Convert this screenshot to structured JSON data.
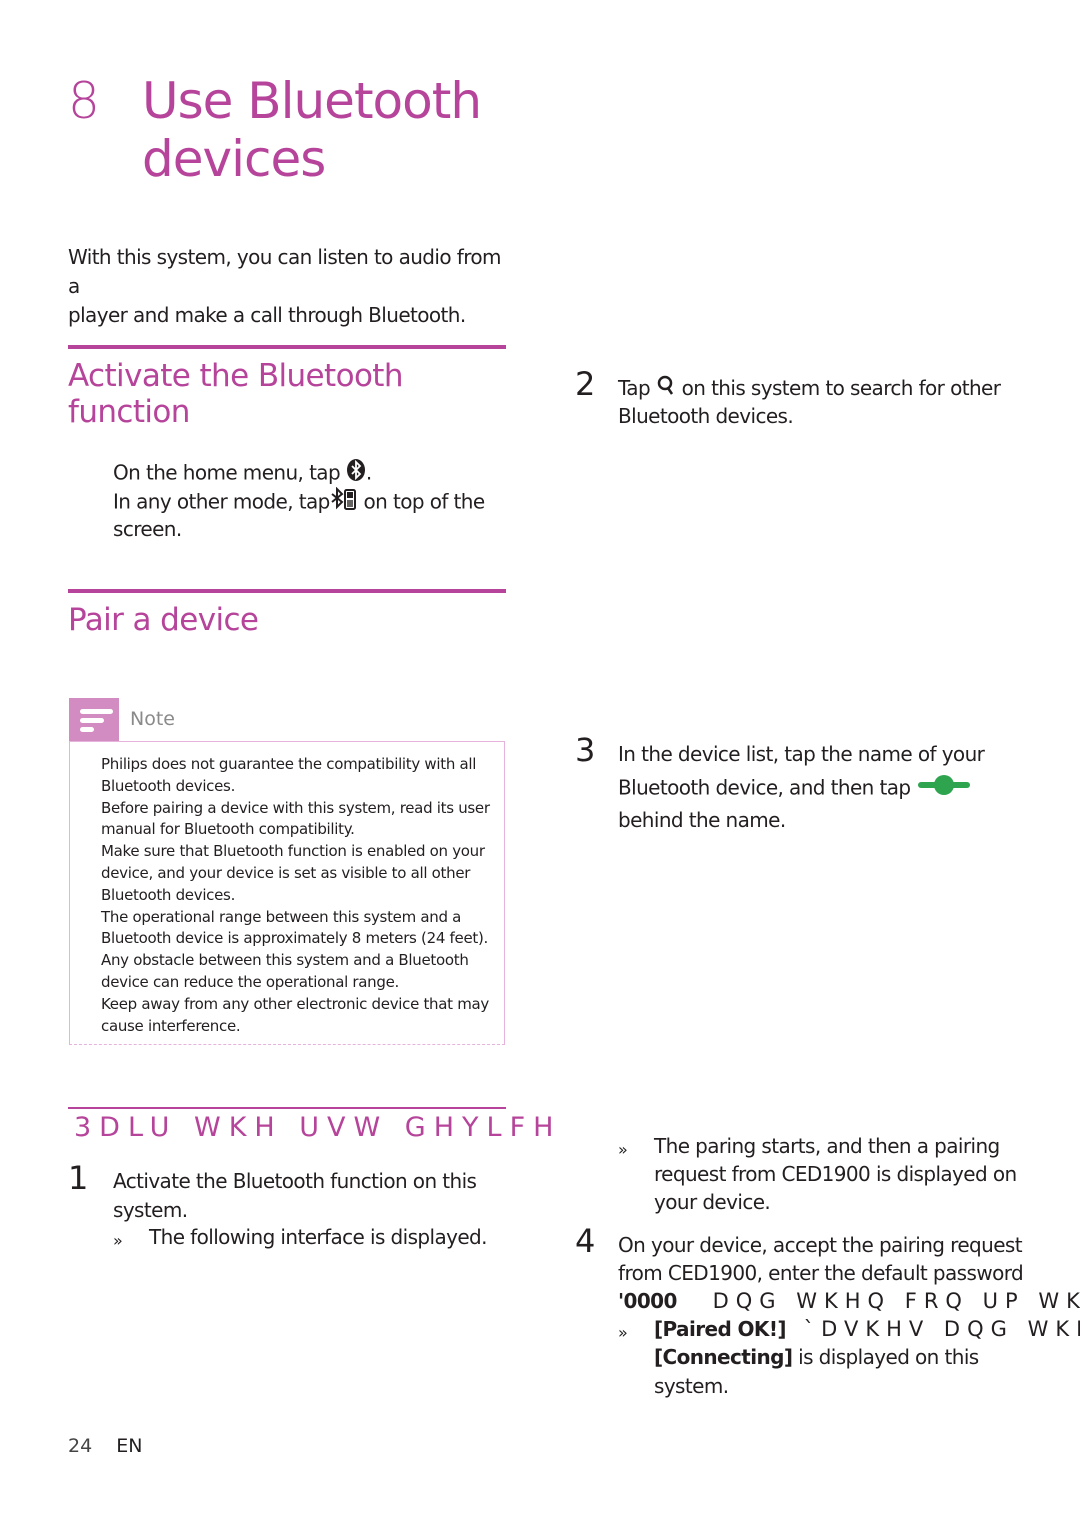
{
  "chapter": {
    "number": "8",
    "title_line1": "Use Bluetooth",
    "title_line2": "devices"
  },
  "intro": {
    "line1": "With this system, you can listen to audio from a",
    "line2": "player and make a call through Bluetooth."
  },
  "activate_section": {
    "heading_line1": "Activate the Bluetooth",
    "heading_line2": "function",
    "line1_before": "On the home menu, tap",
    "line1_after": ".",
    "line2_before": "In any other mode, tap",
    "line2_after": "on top of the",
    "line3": "screen.",
    "icons": [
      "bluetooth-home-icon",
      "bluetooth-phone-icon"
    ]
  },
  "pair_section": {
    "heading": "Pair a device"
  },
  "note": {
    "label": "Note",
    "icon": "note-icon",
    "lines": [
      "Philips does not guarantee the compatibility with all",
      "Bluetooth devices.",
      "Before pairing a device with this system, read its user",
      "manual for Bluetooth compatibility.",
      "Make sure that Bluetooth function is enabled on your",
      "device, and your device is set as visible to all other",
      "Bluetooth devices.",
      "The operational range between this system and a",
      "Bluetooth device is approximately 8 meters (24 feet).",
      "Any obstacle between this system and a Bluetooth",
      "device can reduce the operational range.",
      "Keep away from any other electronic device that may",
      "cause interference."
    ]
  },
  "first_device_section": {
    "heading_garbled": "3DLU WKH  UVW GHYLFH"
  },
  "steps": {
    "step1": {
      "number": "1",
      "line1": "Activate the Bluetooth function on this",
      "line2": "system.",
      "result_bullet": "»",
      "result": "The following interface is displayed."
    },
    "step2": {
      "number": "2",
      "before": "Tap",
      "after": "on this system to search for other",
      "line2": "Bluetooth devices.",
      "icon": "search-icon"
    },
    "step3": {
      "number": "3",
      "line1": "In the device list, tap the name of your",
      "line2_before": "Bluetooth device, and then tap",
      "line3": "behind the name.",
      "icon": "connect-slider-icon",
      "icon_color": "#2ea44f"
    },
    "step3_result": {
      "bullet": "»",
      "line1": "The paring starts, and then a pairing",
      "line2": "request from CED1900 is displayed on",
      "line3": "your device."
    },
    "step4": {
      "number": "4",
      "line1": "On your device, accept the pairing request",
      "line2": "from CED1900, enter the default password",
      "password": "'0000",
      "line3_garbled": "DQG WKHQ FRQ UP WKH",
      "result_bullet": "»",
      "result_bold1": "[Paired OK!]",
      "result_garbled": "`DVKHV  DQG WKH",
      "result_bold2": "[Connecting]",
      "result_line2_after": "is displayed on this",
      "result_line3": "system."
    }
  },
  "footer": {
    "page_number": "24",
    "language": "EN"
  },
  "colors": {
    "accent": "#b5449a",
    "note_tab": "#d38cc2",
    "note_border": "#e6b3dc",
    "text": "#231f20",
    "connect_icon": "#2ea44f"
  }
}
